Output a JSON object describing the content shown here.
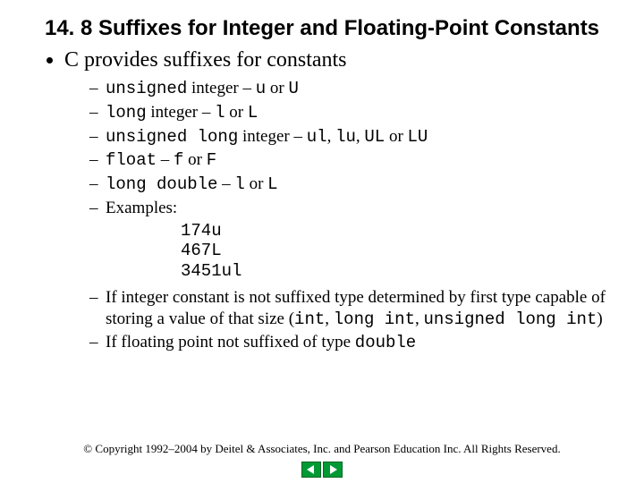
{
  "title": "14. 8  Suffixes for Integer and Floating-Point Constants",
  "bullet_main": "C provides suffixes for constants",
  "sub": {
    "unsigned_pre": "unsigned",
    "unsigned_mid": " integer – ",
    "unsigned_s1": "u",
    "unsigned_or": " or ",
    "unsigned_s2": "U",
    "long_pre": "long",
    "long_mid": " integer – ",
    "long_s1": "l",
    "long_or": " or ",
    "long_s2": "L",
    "ulong_pre": "unsigned long",
    "ulong_mid": " integer – ",
    "ulong_s1": "ul",
    "ulong_c1": ", ",
    "ulong_s2": "lu",
    "ulong_c2": ", ",
    "ulong_s3": "UL",
    "ulong_or": " or ",
    "ulong_s4": "LU",
    "float_pre": "float",
    "float_mid": " – ",
    "float_s1": "f",
    "float_or": " or ",
    "float_s2": "F",
    "ldouble_pre": "long double",
    "ldouble_mid": " – ",
    "ldouble_s1": "l",
    "ldouble_or": " or ",
    "ldouble_s2": "L",
    "examples_label": "Examples:"
  },
  "examples": {
    "e1": "174u",
    "e2": "467L",
    "e3": "3451ul"
  },
  "note_int": {
    "t1": "If integer constant is not suffixed type determined by first type capable of storing a value of that size (",
    "c1": "int",
    "t2": ", ",
    "c2": "long int",
    "t3": ", ",
    "c3": "unsigned long int",
    "t4": ")"
  },
  "note_float": {
    "t1": "If floating point not suffixed of type ",
    "c1": "double"
  },
  "footer": "© Copyright 1992–2004 by Deitel & Associates, Inc. and Pearson Education Inc. All Rights Reserved."
}
